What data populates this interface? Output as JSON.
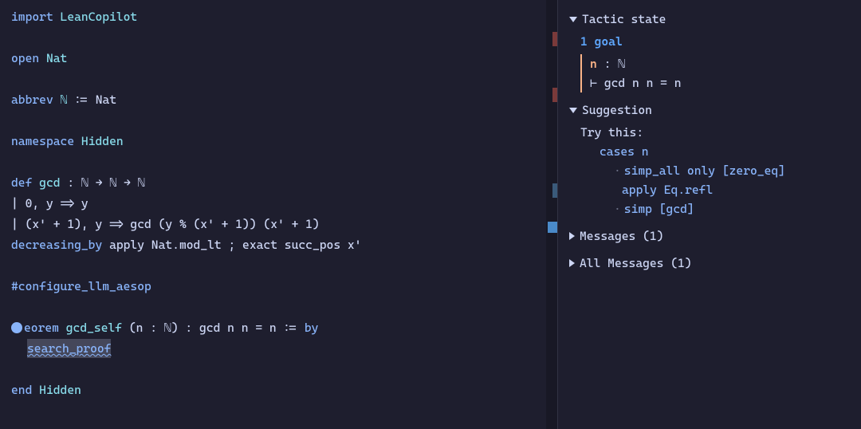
{
  "editor": {
    "lines": {
      "l1_kw": "import",
      "l1_mod": "LeanCopilot",
      "l3_kw": "open",
      "l3_mod": "Nat",
      "l5_kw": "abbrev",
      "l5_name": "ℕ",
      "l5_op": ":=",
      "l5_rhs": "Nat",
      "l7_kw": "namespace",
      "l7_name": "Hidden",
      "l9_kw": "def",
      "l9_name": "gcd",
      "l9_sig": ": ℕ → ℕ → ℕ",
      "l10": "| 0, y => y",
      "l11": "| (x' + 1), y => gcd (y % (x' + 1)) (x' + 1)",
      "l12_kw": "decreasing_by",
      "l12_rest": "apply Nat.mod_lt ; exact succ_pos x'",
      "l14": "#configure_llm_aesop",
      "l16_kw": "eorem",
      "l16_name": "gcd_self",
      "l16_args": "(n : ℕ)",
      "l16_sig": ": gcd n n = n :=",
      "l16_by": "by",
      "l17": "search_proof",
      "l19_kw": "end",
      "l19_name": "Hidden"
    }
  },
  "infoview": {
    "tactic_state": {
      "title": "Tactic state",
      "goal_count": "1 goal",
      "hypothesis_name": "n",
      "hypothesis_type": ": ℕ",
      "goal_prefix": "⊢ ",
      "goal": "gcd n n = n"
    },
    "suggestion": {
      "title": "Suggestion",
      "try_this": "Try this:",
      "line1": "cases n",
      "line2a": "simp_all only [zero_eq]",
      "line2b": "apply Eq.refl",
      "line3": "simp [gcd]"
    },
    "messages": {
      "title": "Messages (1)"
    },
    "all_messages": {
      "title": "All Messages (1)"
    }
  }
}
